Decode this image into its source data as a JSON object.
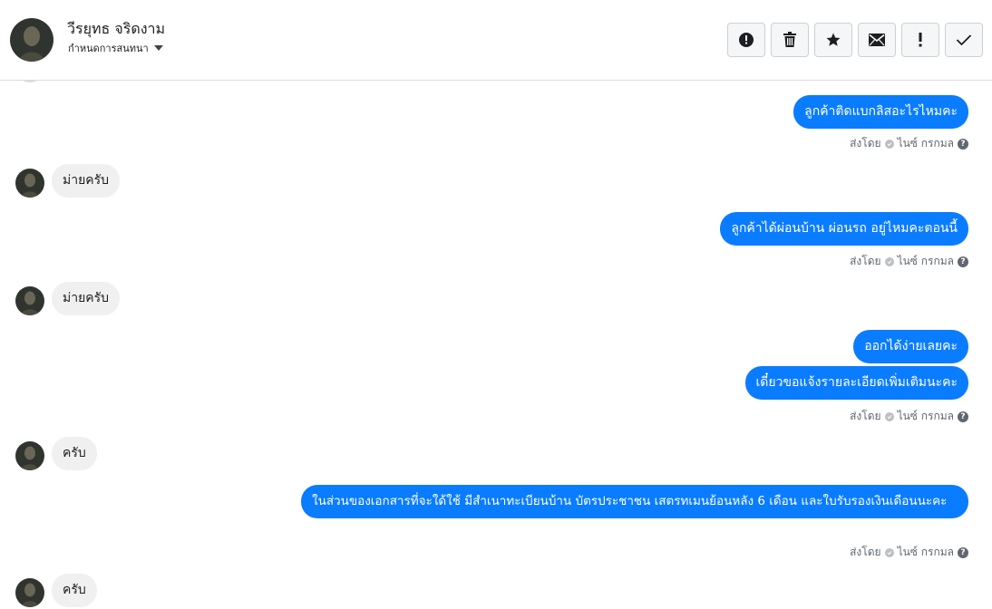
{
  "header": {
    "contact_name": "วีรยุทธ จริดงาม",
    "assign_label": "กำหนดการสนทนา",
    "actions": [
      {
        "name": "mark-spam-button",
        "icon": "alert-circle-icon"
      },
      {
        "name": "delete-button",
        "icon": "trash-icon"
      },
      {
        "name": "star-button",
        "icon": "star-icon"
      },
      {
        "name": "mark-unread-button",
        "icon": "envelope-icon"
      },
      {
        "name": "follow-up-button",
        "icon": "exclamation-icon"
      },
      {
        "name": "mark-done-button",
        "icon": "check-icon"
      }
    ]
  },
  "thread": {
    "m1": "ลูกค้าติดแบกลิสอะไรไหมคะ",
    "m2": "ม่ายครับ",
    "m3": "ลูกค้าได้ผ่อนบ้าน ผ่อนรถ  อยู่ไหมคะตอนนี้",
    "m4": "ม่ายครับ",
    "m5": "ออกได้ง่ายเลยคะ",
    "m6": "เดี๋ยวขอแจ้งรายละเอียดเพิ่มเติมนะคะ",
    "m7": "ครับ",
    "m8": "ในส่วนของเอกสารที่จะใด้ใช้  มีสำเนาทะเบียนบ้าน  บัตรประชาชน  เสตรทเมนย้อนหลัง 6 เดือน และใบรับรองเงินเดือนนะคะ",
    "m9": "ครับ",
    "sent_by_label": "ส่งโดย",
    "sender_name": "ไนซ์ กรกมล",
    "help_glyph": "?"
  },
  "colors": {
    "outgoing_bubble": "#0a7cff",
    "incoming_bubble": "#f0f0f0"
  }
}
